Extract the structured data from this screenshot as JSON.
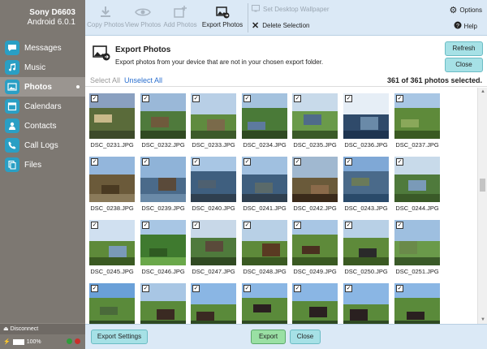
{
  "device": {
    "name": "Sony D6603",
    "os": "Android 6.0.1"
  },
  "nav": [
    {
      "label": "Messages",
      "icon": "messages-icon",
      "active": false
    },
    {
      "label": "Music",
      "icon": "music-icon",
      "active": false
    },
    {
      "label": "Photos",
      "icon": "photos-icon",
      "active": true
    },
    {
      "label": "Calendars",
      "icon": "calendar-icon",
      "active": false
    },
    {
      "label": "Contacts",
      "icon": "contacts-icon",
      "active": false
    },
    {
      "label": "Call Logs",
      "icon": "phone-icon",
      "active": false
    },
    {
      "label": "Files",
      "icon": "files-icon",
      "active": false
    }
  ],
  "sidebar_footer": {
    "disconnect": "Disconnect",
    "battery": "100%"
  },
  "toolbar": {
    "copy_photos": "Copy Photos",
    "view_photos": "View Photos",
    "add_photos": "Add Photos",
    "export_photos": "Export Photos",
    "set_wallpaper": "Set Desktop Wallpaper",
    "delete_selection": "Delete Selection",
    "options": "Options",
    "help": "Help"
  },
  "header": {
    "title": "Export Photos",
    "subtitle": "Export photos from your device that are not in your chosen export folder.",
    "refresh": "Refresh",
    "close": "Close"
  },
  "selection": {
    "select_all": "Select All",
    "unselect_all": "Unselect All",
    "count": "361 of 361 photos selected."
  },
  "photos": [
    "DSC_0231.JPG",
    "DSC_0232.JPG",
    "DSC_0233.JPG",
    "DSC_0234.JPG",
    "DSC_0235.JPG",
    "DSC_0236.JPG",
    "DSC_0237.JPG",
    "DSC_0238.JPG",
    "DSC_0239.JPG",
    "DSC_0240.JPG",
    "DSC_0241.JPG",
    "DSC_0242.JPG",
    "DSC_0243.JPG",
    "DSC_0244.JPG",
    "DSC_0245.JPG",
    "DSC_0246.JPG",
    "DSC_0247.JPG",
    "DSC_0248.JPG",
    "DSC_0249.JPG",
    "DSC_0250.JPG",
    "DSC_0251.JPG",
    "",
    "",
    "",
    "",
    "",
    "",
    ""
  ],
  "footer": {
    "export_settings": "Export Settings",
    "export": "Export",
    "close": "Close"
  },
  "colors": {
    "sidebar": "#7d7872",
    "accent": "#2a9fc4",
    "toolbar": "#dbe9f6",
    "button": "#a6e1e6",
    "export_button": "#9ae0a4"
  }
}
